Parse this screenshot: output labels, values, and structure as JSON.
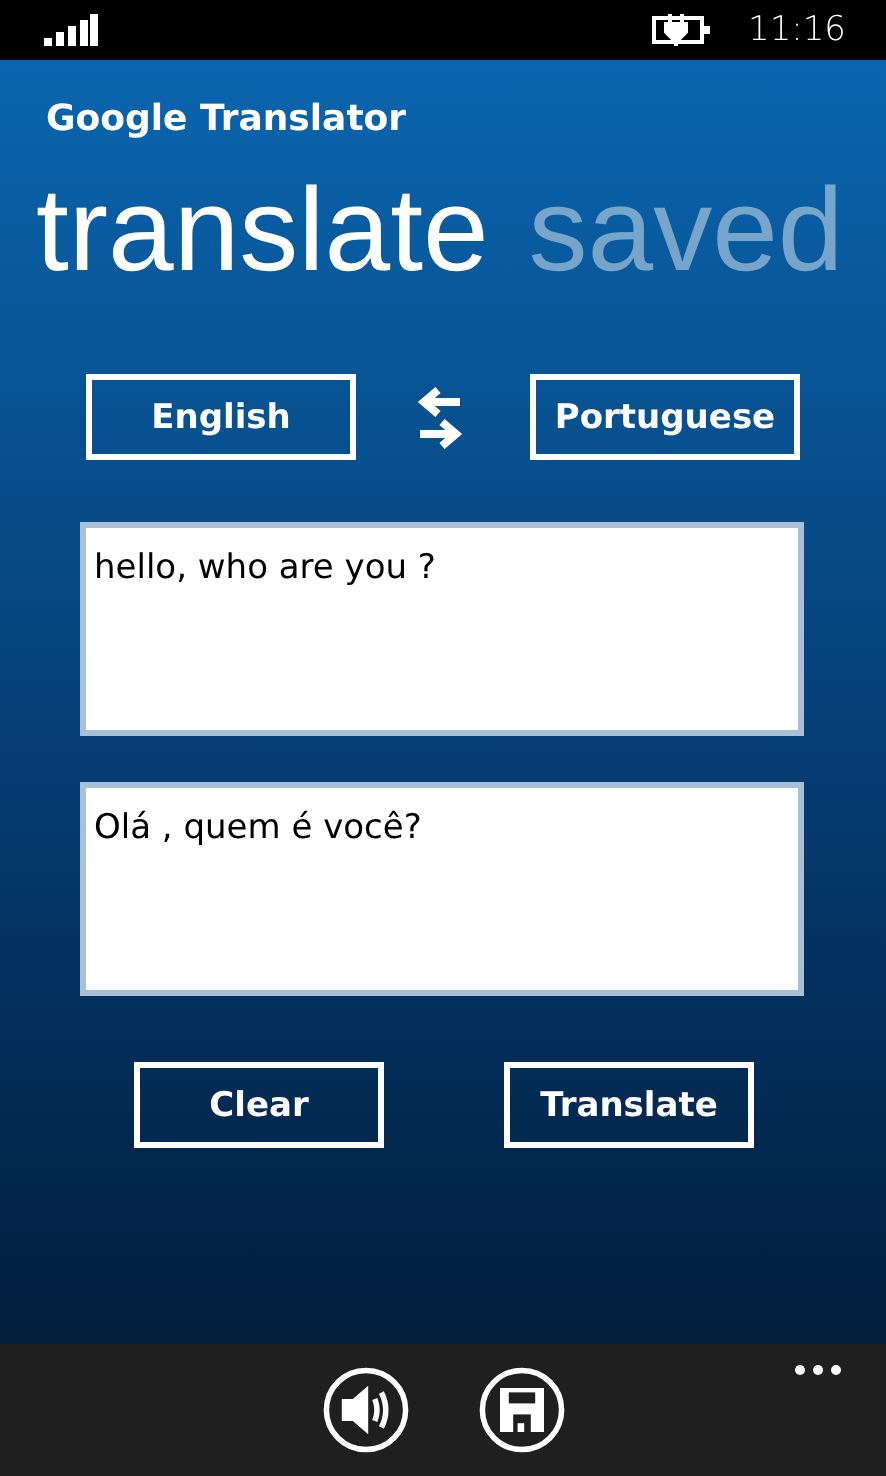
{
  "status_bar": {
    "time": "11:16"
  },
  "app": {
    "title": "Google Translator"
  },
  "pivot": [
    {
      "label": "translate",
      "selected": true
    },
    {
      "label": "saved",
      "selected": false
    }
  ],
  "languages": {
    "source": "English",
    "target": "Portuguese"
  },
  "input": {
    "value": "hello, who are you ?"
  },
  "output": {
    "value": "Olá , quem é você?"
  },
  "buttons": [
    "Clear",
    "Translate"
  ],
  "app_bar": {
    "buttons": [
      {
        "kind": "speak"
      },
      {
        "kind": "save"
      }
    ]
  }
}
